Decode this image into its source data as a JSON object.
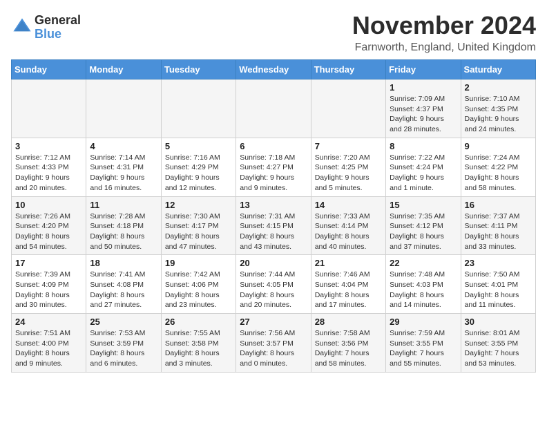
{
  "logo": {
    "text_general": "General",
    "text_blue": "Blue"
  },
  "header": {
    "month": "November 2024",
    "location": "Farnworth, England, United Kingdom"
  },
  "days_of_week": [
    "Sunday",
    "Monday",
    "Tuesday",
    "Wednesday",
    "Thursday",
    "Friday",
    "Saturday"
  ],
  "weeks": [
    [
      {
        "day": "",
        "info": ""
      },
      {
        "day": "",
        "info": ""
      },
      {
        "day": "",
        "info": ""
      },
      {
        "day": "",
        "info": ""
      },
      {
        "day": "",
        "info": ""
      },
      {
        "day": "1",
        "info": "Sunrise: 7:09 AM\nSunset: 4:37 PM\nDaylight: 9 hours and 28 minutes."
      },
      {
        "day": "2",
        "info": "Sunrise: 7:10 AM\nSunset: 4:35 PM\nDaylight: 9 hours and 24 minutes."
      }
    ],
    [
      {
        "day": "3",
        "info": "Sunrise: 7:12 AM\nSunset: 4:33 PM\nDaylight: 9 hours and 20 minutes."
      },
      {
        "day": "4",
        "info": "Sunrise: 7:14 AM\nSunset: 4:31 PM\nDaylight: 9 hours and 16 minutes."
      },
      {
        "day": "5",
        "info": "Sunrise: 7:16 AM\nSunset: 4:29 PM\nDaylight: 9 hours and 12 minutes."
      },
      {
        "day": "6",
        "info": "Sunrise: 7:18 AM\nSunset: 4:27 PM\nDaylight: 9 hours and 9 minutes."
      },
      {
        "day": "7",
        "info": "Sunrise: 7:20 AM\nSunset: 4:25 PM\nDaylight: 9 hours and 5 minutes."
      },
      {
        "day": "8",
        "info": "Sunrise: 7:22 AM\nSunset: 4:24 PM\nDaylight: 9 hours and 1 minute."
      },
      {
        "day": "9",
        "info": "Sunrise: 7:24 AM\nSunset: 4:22 PM\nDaylight: 8 hours and 58 minutes."
      }
    ],
    [
      {
        "day": "10",
        "info": "Sunrise: 7:26 AM\nSunset: 4:20 PM\nDaylight: 8 hours and 54 minutes."
      },
      {
        "day": "11",
        "info": "Sunrise: 7:28 AM\nSunset: 4:18 PM\nDaylight: 8 hours and 50 minutes."
      },
      {
        "day": "12",
        "info": "Sunrise: 7:30 AM\nSunset: 4:17 PM\nDaylight: 8 hours and 47 minutes."
      },
      {
        "day": "13",
        "info": "Sunrise: 7:31 AM\nSunset: 4:15 PM\nDaylight: 8 hours and 43 minutes."
      },
      {
        "day": "14",
        "info": "Sunrise: 7:33 AM\nSunset: 4:14 PM\nDaylight: 8 hours and 40 minutes."
      },
      {
        "day": "15",
        "info": "Sunrise: 7:35 AM\nSunset: 4:12 PM\nDaylight: 8 hours and 37 minutes."
      },
      {
        "day": "16",
        "info": "Sunrise: 7:37 AM\nSunset: 4:11 PM\nDaylight: 8 hours and 33 minutes."
      }
    ],
    [
      {
        "day": "17",
        "info": "Sunrise: 7:39 AM\nSunset: 4:09 PM\nDaylight: 8 hours and 30 minutes."
      },
      {
        "day": "18",
        "info": "Sunrise: 7:41 AM\nSunset: 4:08 PM\nDaylight: 8 hours and 27 minutes."
      },
      {
        "day": "19",
        "info": "Sunrise: 7:42 AM\nSunset: 4:06 PM\nDaylight: 8 hours and 23 minutes."
      },
      {
        "day": "20",
        "info": "Sunrise: 7:44 AM\nSunset: 4:05 PM\nDaylight: 8 hours and 20 minutes."
      },
      {
        "day": "21",
        "info": "Sunrise: 7:46 AM\nSunset: 4:04 PM\nDaylight: 8 hours and 17 minutes."
      },
      {
        "day": "22",
        "info": "Sunrise: 7:48 AM\nSunset: 4:03 PM\nDaylight: 8 hours and 14 minutes."
      },
      {
        "day": "23",
        "info": "Sunrise: 7:50 AM\nSunset: 4:01 PM\nDaylight: 8 hours and 11 minutes."
      }
    ],
    [
      {
        "day": "24",
        "info": "Sunrise: 7:51 AM\nSunset: 4:00 PM\nDaylight: 8 hours and 9 minutes."
      },
      {
        "day": "25",
        "info": "Sunrise: 7:53 AM\nSunset: 3:59 PM\nDaylight: 8 hours and 6 minutes."
      },
      {
        "day": "26",
        "info": "Sunrise: 7:55 AM\nSunset: 3:58 PM\nDaylight: 8 hours and 3 minutes."
      },
      {
        "day": "27",
        "info": "Sunrise: 7:56 AM\nSunset: 3:57 PM\nDaylight: 8 hours and 0 minutes."
      },
      {
        "day": "28",
        "info": "Sunrise: 7:58 AM\nSunset: 3:56 PM\nDaylight: 7 hours and 58 minutes."
      },
      {
        "day": "29",
        "info": "Sunrise: 7:59 AM\nSunset: 3:55 PM\nDaylight: 7 hours and 55 minutes."
      },
      {
        "day": "30",
        "info": "Sunrise: 8:01 AM\nSunset: 3:55 PM\nDaylight: 7 hours and 53 minutes."
      }
    ]
  ]
}
